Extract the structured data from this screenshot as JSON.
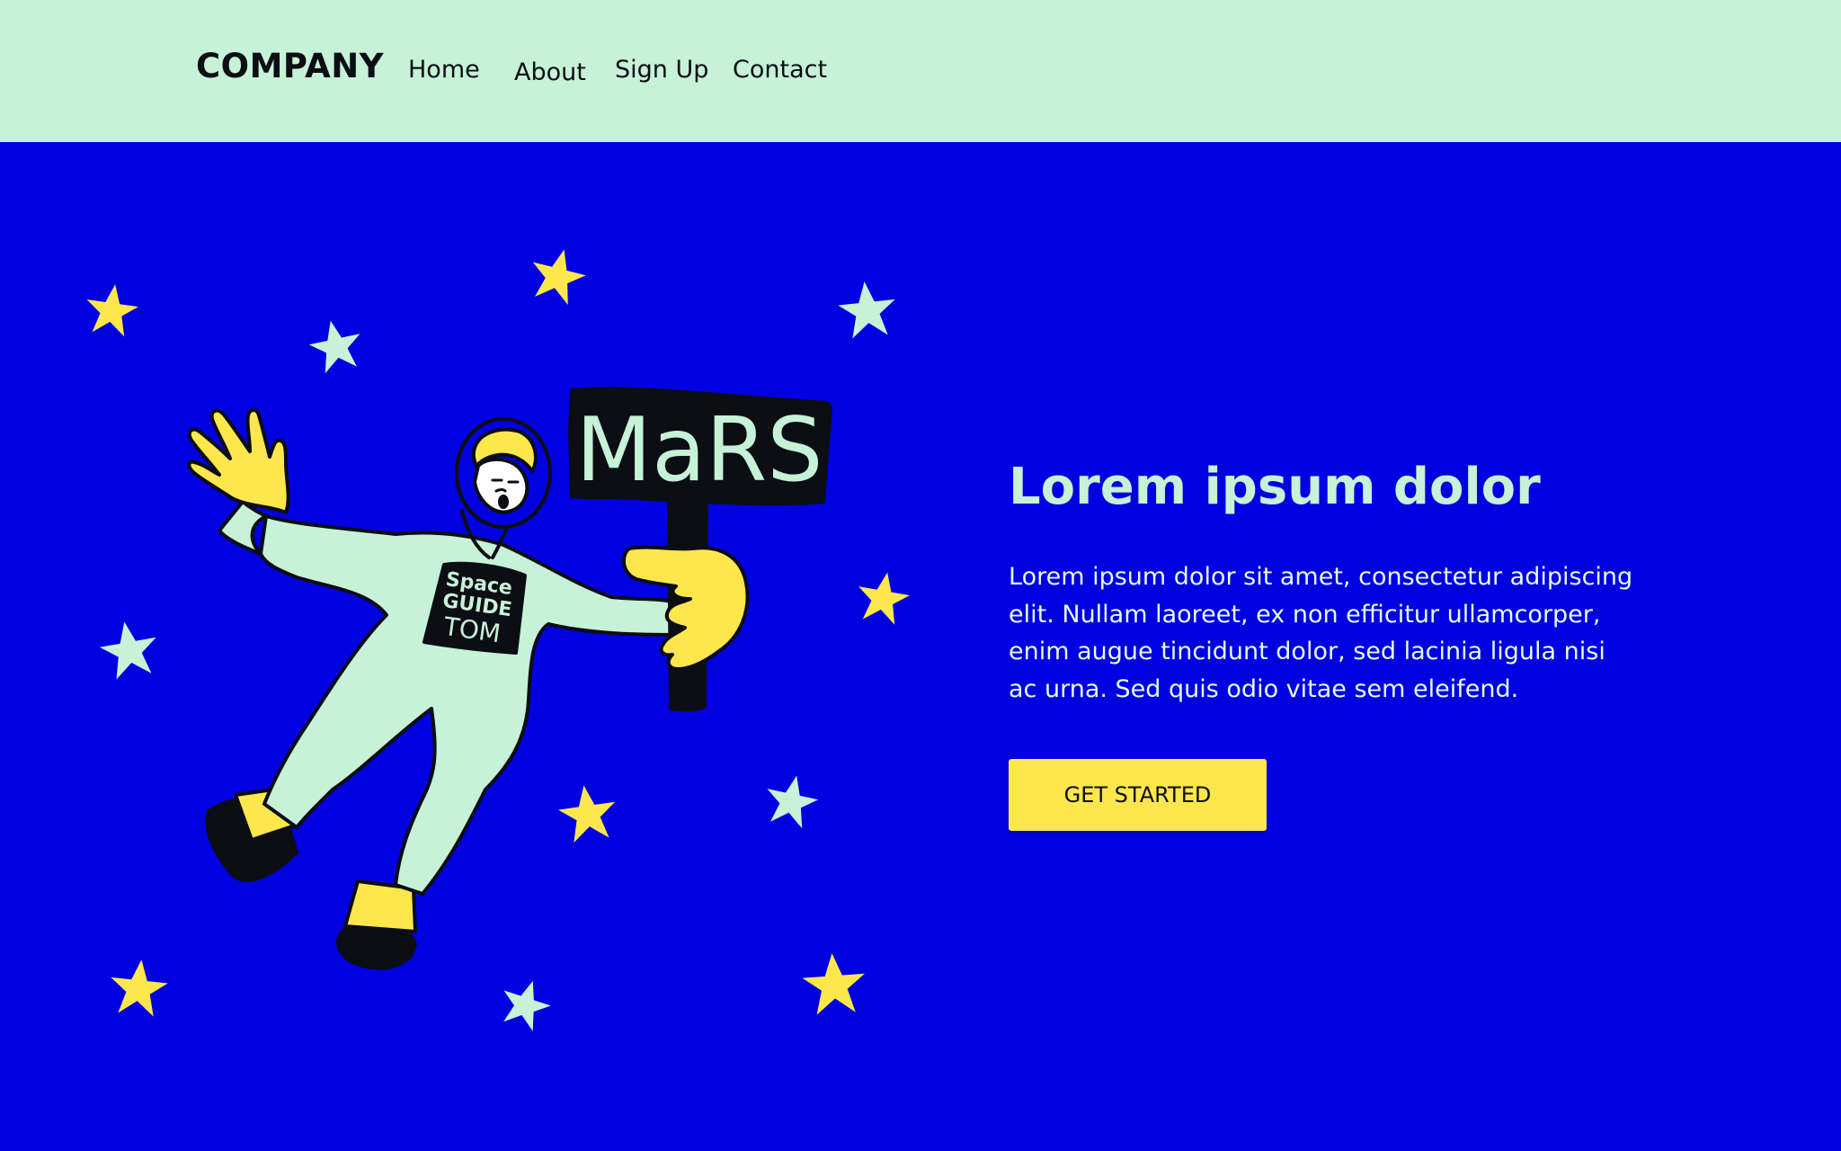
{
  "header": {
    "brand": "COMPANY",
    "nav": [
      {
        "label": "Home"
      },
      {
        "label": "About"
      },
      {
        "label": "Sign Up"
      },
      {
        "label": "Contact"
      }
    ]
  },
  "hero": {
    "title": "Lorem ipsum dolor",
    "body": "Lorem ipsum dolor sit amet, consectetur adipiscing elit. Nullam laoreet, ex non efficitur ullamcorper, enim augue tincidunt dolor, sed lacinia ligula nisi ac urna. Sed quis odio vitae sem eleifend.",
    "cta_label": "GET STARTED"
  },
  "illustration": {
    "sign_text": "MaRS",
    "badge_lines": [
      "Space",
      "GUIDE",
      "TOM"
    ]
  },
  "colors": {
    "header_bg": "#c6f2d8",
    "hero_bg": "#0000e0",
    "accent_yellow": "#fde74c",
    "mint": "#c6f2d8",
    "ink": "#0d0d14"
  },
  "icons": {
    "stars": "star-icon",
    "figure": "astronaut-icon"
  }
}
